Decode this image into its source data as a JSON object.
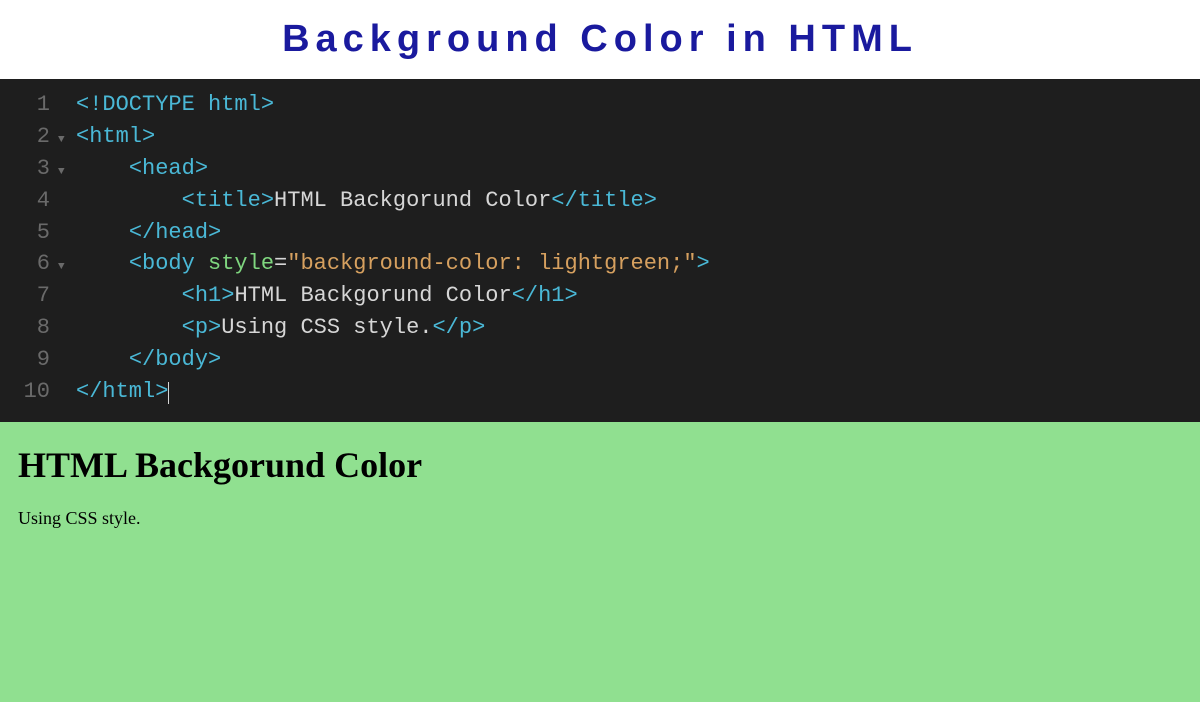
{
  "header": {
    "title": "Background Color in HTML"
  },
  "code": {
    "lines": [
      {
        "num": "1",
        "fold": "",
        "indent": "",
        "pre": "<!DOCTYPE html",
        "text": "",
        "post": ">"
      },
      {
        "num": "2",
        "fold": "▼",
        "indent": "",
        "pre": "<html>",
        "text": "",
        "post": ""
      },
      {
        "num": "3",
        "fold": "▼",
        "indent": "    ",
        "pre": "<head>",
        "text": "",
        "post": ""
      },
      {
        "num": "4",
        "fold": "",
        "indent": "        ",
        "pre": "<title>",
        "text": "HTML Backgorund Color",
        "post": "</title>"
      },
      {
        "num": "5",
        "fold": "",
        "indent": "    ",
        "pre": "</head>",
        "text": "",
        "post": ""
      },
      {
        "num": "6",
        "fold": "▼",
        "indent": "    ",
        "pre_open": "<body",
        "attr_name": "style",
        "attr_eq": "=",
        "attr_val": "\"background-color: lightgreen;\"",
        "pre_close": ">"
      },
      {
        "num": "7",
        "fold": "",
        "indent": "        ",
        "pre": "<h1>",
        "text": "HTML Backgorund Color",
        "post": "</h1>"
      },
      {
        "num": "8",
        "fold": "",
        "indent": "        ",
        "pre": "<p>",
        "text": "Using CSS style.",
        "post": "</p>"
      },
      {
        "num": "9",
        "fold": "",
        "indent": "    ",
        "pre": "</body>",
        "text": "",
        "post": ""
      },
      {
        "num": "10",
        "fold": "",
        "indent": "",
        "pre": "</html>",
        "text": "",
        "post": "",
        "cursor": true
      }
    ]
  },
  "output": {
    "heading": "HTML Backgorund Color",
    "paragraph": "Using CSS style.",
    "bg_color": "#90e090"
  }
}
